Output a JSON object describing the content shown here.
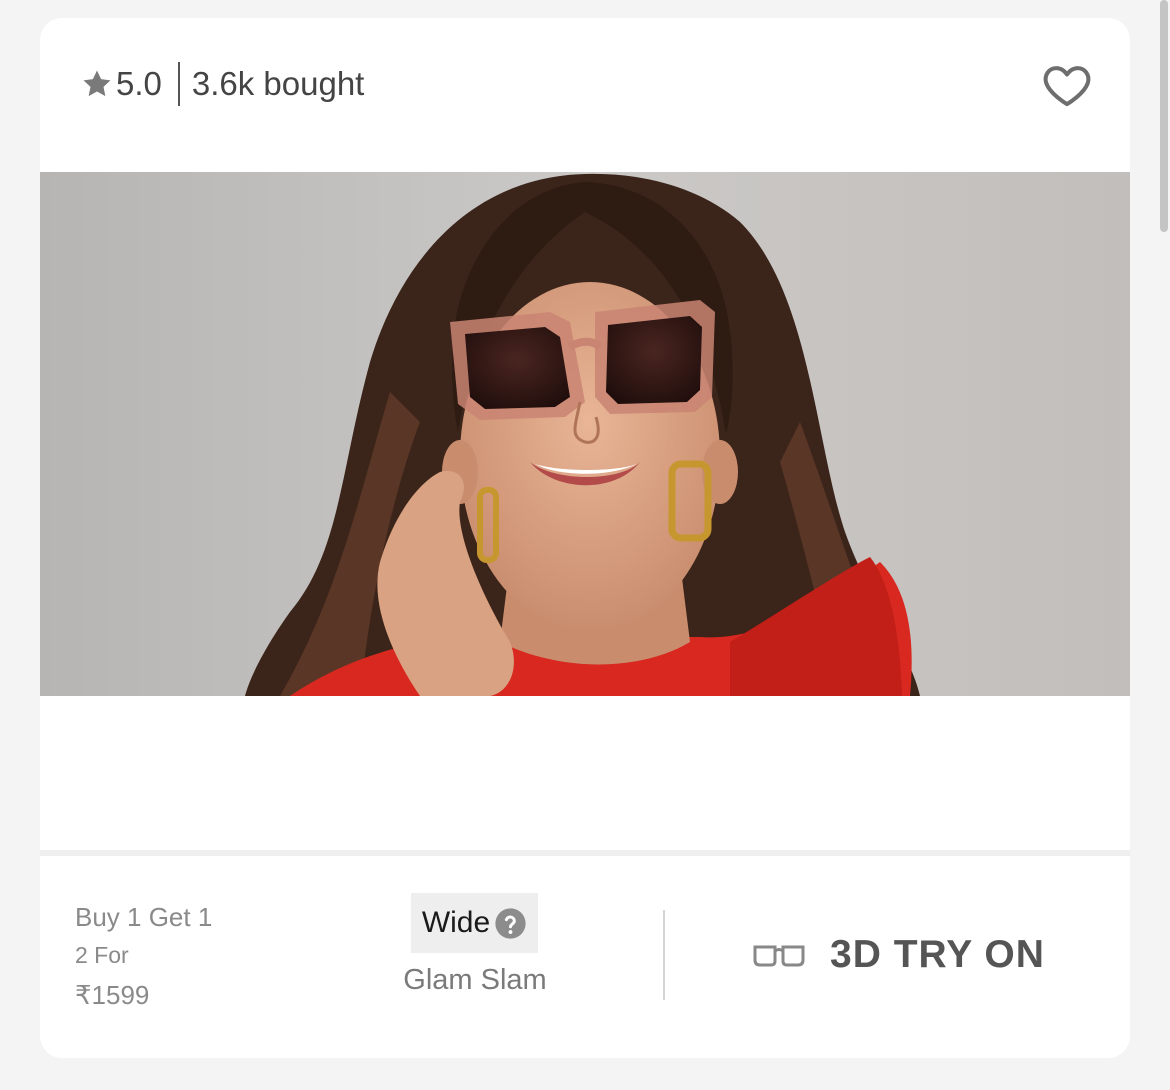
{
  "product_card": {
    "rating": "5.0",
    "bought": "3.6k bought",
    "offer": {
      "line1": "Buy 1 Get 1",
      "line2": "2 For",
      "price": "₹1599"
    },
    "size_chip": "Wide",
    "collection": "Glam Slam",
    "try_on_label": "3D TRY ON"
  },
  "icons": {
    "rating": "star-icon",
    "wishlist": "heart-outline-icon",
    "size_help": "question-icon",
    "try_on": "glasses-icon"
  },
  "colors": {
    "card_bg": "#ffffff",
    "page_bg": "#f4f4f4",
    "text_primary": "#444444",
    "text_muted": "#8a8a8a"
  }
}
